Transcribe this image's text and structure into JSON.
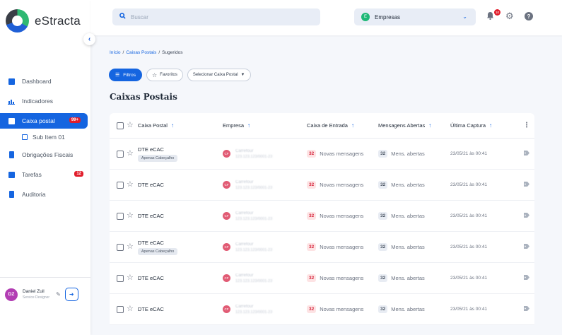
{
  "app": {
    "name": "eStracta"
  },
  "search": {
    "placeholder": "Buscar"
  },
  "company_select": {
    "initial": "E",
    "label": "Empresas"
  },
  "notifications": {
    "badge": "10"
  },
  "sidebar": {
    "items": [
      {
        "label": "Dashboard"
      },
      {
        "label": "Indicadores"
      },
      {
        "label": "Caixa postal",
        "badge": "99+"
      },
      {
        "label": "Sub Item 01"
      },
      {
        "label": "Obrigações Fiscais"
      },
      {
        "label": "Tarefas",
        "badge": "12"
      },
      {
        "label": "Auditoria"
      }
    ]
  },
  "user": {
    "initials": "DZ",
    "name": "Daniel Zuil",
    "role": "Service Designer"
  },
  "breadcrumb": {
    "items": [
      "Início",
      "Caixas Postais",
      "Sugeridos"
    ],
    "separator": "/"
  },
  "toolbar": {
    "filters": "Filtros",
    "favorites": "Favoritos",
    "select_mailbox": "Selecionar Caixa Postal"
  },
  "page": {
    "title": "Caixas Postais"
  },
  "table": {
    "columns": [
      "Caixa Postal",
      "Empresa",
      "Caixa de Entrada",
      "Mensagens Abertas",
      "Última Captura"
    ],
    "rows": [
      {
        "title": "DTE eCAC",
        "tag": "Apenas Cabeçalho",
        "company_initials": "CF",
        "company_name": "Carrefour",
        "company_id": "123.123.123/0001-23",
        "inbox_count": "32",
        "inbox_label": "Novas mensagens",
        "open_count": "32",
        "open_label": "Mens. abertas",
        "last_capture": "23/05/21 às 00:41"
      },
      {
        "title": "DTE eCAC",
        "tag": "",
        "company_initials": "CF",
        "company_name": "Carrefour",
        "company_id": "123.123.123/0001-23",
        "inbox_count": "32",
        "inbox_label": "Novas mensagens",
        "open_count": "32",
        "open_label": "Mens. abertas",
        "last_capture": "23/05/21 às 00:41"
      },
      {
        "title": "DTE eCAC",
        "tag": "",
        "company_initials": "CF",
        "company_name": "Carrefour",
        "company_id": "123.123.123/0001-23",
        "inbox_count": "32",
        "inbox_label": "Novas mensagens",
        "open_count": "32",
        "open_label": "Mens. abertas",
        "last_capture": "23/05/21 às 00:41"
      },
      {
        "title": "DTE eCAC",
        "tag": "Apenas Cabeçalho",
        "company_initials": "CF",
        "company_name": "Carrefour",
        "company_id": "123.123.123/0001-23",
        "inbox_count": "32",
        "inbox_label": "Novas mensagens",
        "open_count": "32",
        "open_label": "Mens. abertas",
        "last_capture": "23/05/21 às 00:41"
      },
      {
        "title": "DTE eCAC",
        "tag": "",
        "company_initials": "CF",
        "company_name": "Carrefour",
        "company_id": "123.123.123/0001-23",
        "inbox_count": "32",
        "inbox_label": "Novas mensagens",
        "open_count": "32",
        "open_label": "Mens. abertas",
        "last_capture": "23/05/21 às 00:41"
      },
      {
        "title": "DTE eCAC",
        "tag": "",
        "company_initials": "CF",
        "company_name": "Carrefour",
        "company_id": "123.123.123/0001-23",
        "inbox_count": "32",
        "inbox_label": "Novas mensagens",
        "open_count": "32",
        "open_label": "Mens. abertas",
        "last_capture": "23/05/21 às 00:41"
      }
    ]
  },
  "colors": {
    "primary": "#1565e0",
    "danger": "#e11d2b",
    "success": "#1fb877"
  },
  "icons": {
    "search": "search-icon",
    "bell": "bell-icon",
    "gear": "gear-icon",
    "help": "help-icon",
    "star": "star-icon",
    "tag": "tag-icon"
  }
}
